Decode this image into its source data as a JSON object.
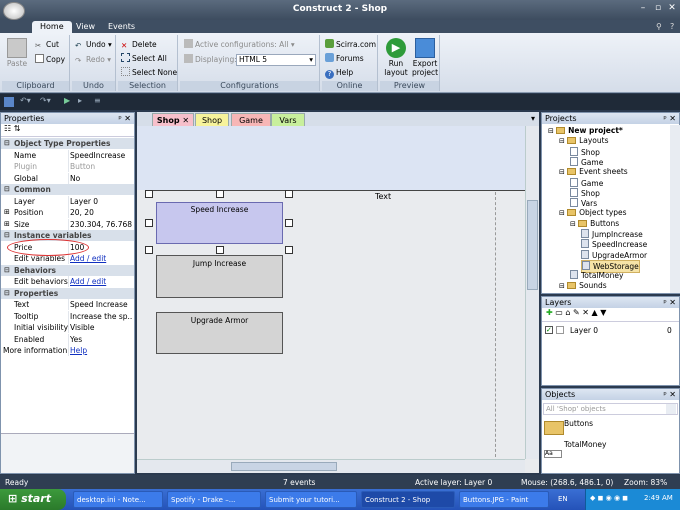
{
  "window": {
    "title": "Construct 2 - Shop"
  },
  "ribbon_tabs": [
    "Home",
    "View",
    "Events"
  ],
  "clipboard": {
    "paste": "Paste",
    "cut": "Cut",
    "copy": "Copy",
    "label": "Clipboard"
  },
  "undo": {
    "undo": "Undo",
    "redo": "Redo",
    "label": "Undo"
  },
  "selection": {
    "delete": "Delete",
    "select_all": "Select All",
    "select_none": "Select None",
    "label": "Selection"
  },
  "configurations": {
    "active": "Active configurations: All",
    "displaying_label": "Displaying:",
    "displaying_value": "HTML 5",
    "label": "Configurations"
  },
  "online": {
    "scirra": "Scirra.com",
    "forums": "Forums",
    "help": "Help",
    "label": "Online"
  },
  "preview": {
    "run": "Run layout",
    "export": "Export project",
    "label": "Preview"
  },
  "properties": {
    "title": "Properties",
    "rows": [
      {
        "type": "cat",
        "key": "Object Type Properties"
      },
      {
        "key": "Name",
        "value": "SpeedIncrease"
      },
      {
        "key": "Plugin",
        "value": "Button",
        "disabled": true
      },
      {
        "key": "Global",
        "value": "No"
      },
      {
        "type": "cat",
        "key": "Common"
      },
      {
        "key": "Layer",
        "value": "Layer 0"
      },
      {
        "key": "Position",
        "value": "20, 20",
        "toggle": "+"
      },
      {
        "key": "Size",
        "value": "230.304, 76.768",
        "toggle": "+"
      },
      {
        "type": "cat",
        "key": "Instance variables"
      },
      {
        "key": "Price",
        "value": "100"
      },
      {
        "key": "Edit variables",
        "value": "Add / edit",
        "link": true
      },
      {
        "type": "cat",
        "key": "Behaviors"
      },
      {
        "key": "Edit behaviors",
        "value": "Add / edit",
        "link": true
      },
      {
        "type": "cat",
        "key": "Properties"
      },
      {
        "key": "Text",
        "value": "Speed Increase"
      },
      {
        "key": "Tooltip",
        "value": "Increase the sp..."
      },
      {
        "key": "Initial visibility",
        "value": "Visible"
      },
      {
        "key": "Enabled",
        "value": "Yes"
      },
      {
        "key": "More information",
        "value": "Help",
        "link": true,
        "full": true
      }
    ]
  },
  "doc_tabs": [
    {
      "label": "Shop",
      "color": "#f7c0cb",
      "close": true
    },
    {
      "label": "Shop",
      "color": "#f7f39b"
    },
    {
      "label": "Game",
      "color": "#f7b6b6"
    },
    {
      "label": "Vars",
      "color": "#c8ef9c"
    }
  ],
  "canvas": {
    "text_object": "Text",
    "buttons": [
      "Speed Increase",
      "Jump Increase",
      "Upgrade Armor"
    ]
  },
  "projects": {
    "title": "Projects",
    "tree": [
      {
        "label": "New project*",
        "depth": 0,
        "kind": "folder",
        "bold": true
      },
      {
        "label": "Layouts",
        "depth": 1,
        "kind": "folder"
      },
      {
        "label": "Shop",
        "depth": 2,
        "kind": "doc"
      },
      {
        "label": "Game",
        "depth": 2,
        "kind": "doc"
      },
      {
        "label": "Event sheets",
        "depth": 1,
        "kind": "folder"
      },
      {
        "label": "Game",
        "depth": 2,
        "kind": "doc"
      },
      {
        "label": "Shop",
        "depth": 2,
        "kind": "doc"
      },
      {
        "label": "Vars",
        "depth": 2,
        "kind": "doc"
      },
      {
        "label": "Object types",
        "depth": 1,
        "kind": "folder"
      },
      {
        "label": "Buttons",
        "depth": 2,
        "kind": "folder"
      },
      {
        "label": "JumpIncrease",
        "depth": 3,
        "kind": "obj"
      },
      {
        "label": "SpeedIncrease",
        "depth": 3,
        "kind": "obj"
      },
      {
        "label": "UpgradeArmor",
        "depth": 3,
        "kind": "obj"
      },
      {
        "label": "WebStorage",
        "depth": 3,
        "kind": "obj",
        "selected": true
      },
      {
        "label": "TotalMoney",
        "depth": 2,
        "kind": "obj"
      },
      {
        "label": "Sounds",
        "depth": 1,
        "kind": "folder"
      }
    ]
  },
  "layers": {
    "title": "Layers",
    "items": [
      {
        "name": "Layer 0",
        "index": "0"
      }
    ]
  },
  "objects": {
    "title": "Objects",
    "filter": "All 'Shop' objects",
    "items": [
      "Buttons",
      "TotalMoney"
    ]
  },
  "status": {
    "ready": "Ready",
    "events": "7 events",
    "active_layer": "Active layer: Layer 0",
    "mouse": "Mouse: (268.6, 486.1, 0)",
    "zoom": "Zoom: 83%"
  },
  "taskbar": {
    "start": "start",
    "items": [
      "desktop.ini - Note...",
      "Spotify - Drake –...",
      "Submit your tutori...",
      "Construct 2 - Shop",
      "Buttons.JPG - Paint"
    ],
    "lang": "EN",
    "clock": "2:49 AM"
  }
}
